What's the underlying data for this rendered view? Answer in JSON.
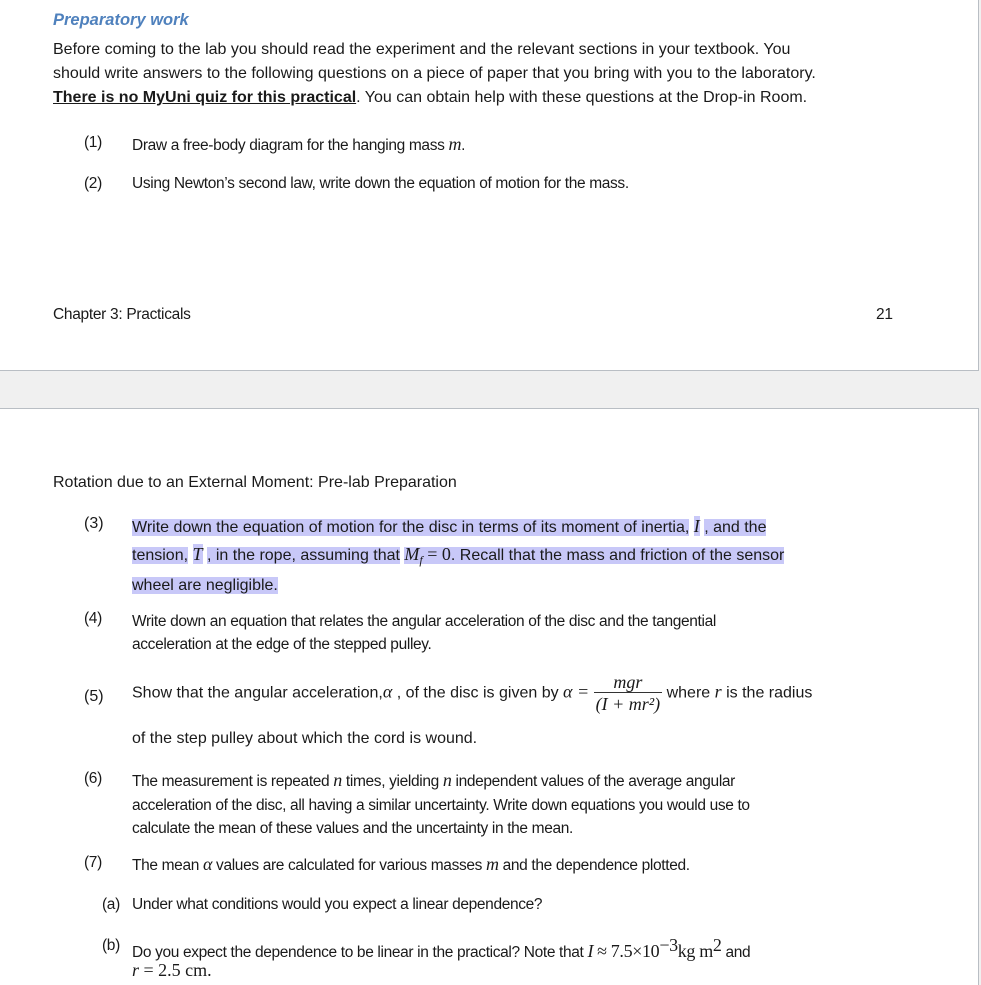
{
  "page1": {
    "heading": "Preparatory work",
    "intro_line1": "Before coming to the lab you should read the experiment and the relevant sections in your textbook. You",
    "intro_line2": "should write answers to the following questions on a piece of paper that you bring with you to the laboratory.",
    "intro_bold": "There is no MyUni quiz for this practical",
    "intro_line3_rest": ". You can obtain help with these questions at the Drop-in Room.",
    "items": [
      {
        "num": "(1)",
        "text": "Draw a free-body diagram for the hanging mass",
        "math": "m",
        "after": "."
      },
      {
        "num": "(2)",
        "text": "Using Newton’s second law, write down the equation of motion for the mass."
      }
    ],
    "footer_left": "Chapter 3: Practicals",
    "footer_right": "21"
  },
  "page2": {
    "section_title": "Rotation due to an External Moment: Pre-lab Preparation",
    "q3": {
      "num": "(3)",
      "line1a": "Write down the equation of motion for the disc in terms of its moment of inertia,",
      "line1_math": "I",
      "line1b": ", and the",
      "line2a": "tension,",
      "line2_math": "T",
      "line2b": ", in the rope, assuming that",
      "line2_math2": "M",
      "line2_math2_sub": "f",
      "line2_eq": "= 0",
      "line2c": ". Recall that the mass and friction of the sensor",
      "line3": "wheel are negligible."
    },
    "q4": {
      "num": "(4)",
      "line1": "Write down an equation that relates the angular acceleration of the disc and the tangential",
      "line2": "acceleration at the edge of the stepped pulley."
    },
    "q5": {
      "num": "(5)",
      "line1a": "Show that the angular acceleration,",
      "alpha": "α",
      "line1b": ", of the disc is given by",
      "eq_lhs": "α =",
      "numerator": "mgr",
      "denominator": "(I + mr²)",
      "line1c": "where",
      "r": "r",
      "line1d": "is the radius",
      "line2": "of the step pulley about which the cord is wound."
    },
    "q6": {
      "num": "(6)",
      "line1a": "The measurement is repeated",
      "n1": "n",
      "line1b": "times, yielding",
      "n2": "n",
      "line1c": "independent values of the average angular",
      "line2": "acceleration of the disc, all having a similar uncertainty. Write down equations you would use to",
      "line3": "calculate the mean of these values and the uncertainty in the mean."
    },
    "q7": {
      "num": "(7)",
      "line1a": "The mean",
      "alpha": "α",
      "line1b": "values are calculated for various masses",
      "m": "m",
      "line1c": "and the dependence plotted.",
      "a_label": "(a)",
      "a_text": "Under what conditions would you expect a linear dependence?",
      "b_label": "(b)",
      "b_text": "Do you expect the dependence to be linear in the practical? Note that",
      "b_I": "I",
      "b_value": "≈ 7.5×10",
      "b_exp": "−3",
      "b_unit": "kg m",
      "b_unit_exp": "2",
      "b_and": "and",
      "b_r": "r",
      "b_r_value": "= 2.5 cm."
    }
  }
}
